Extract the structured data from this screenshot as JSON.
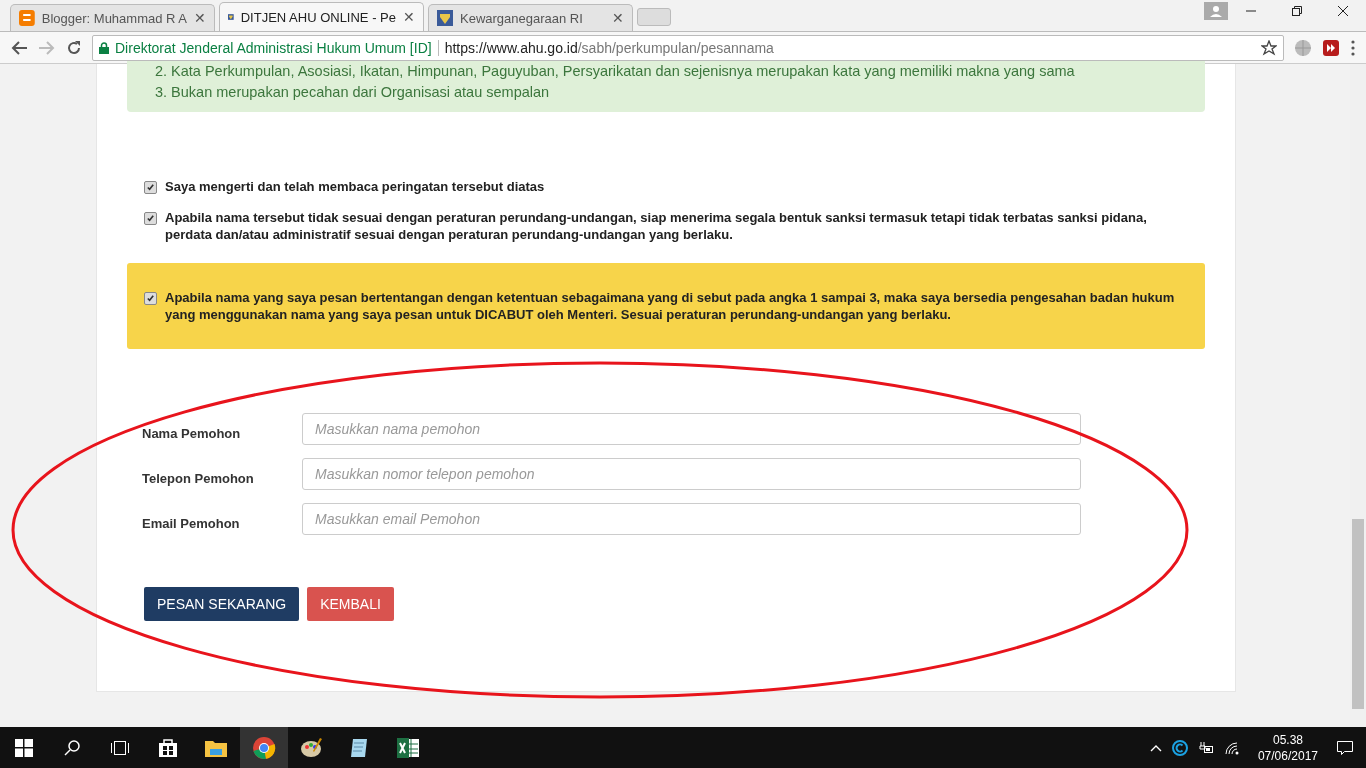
{
  "browser": {
    "tabs": [
      {
        "title": "Blogger: Muhammad R A",
        "kind": "blogger",
        "selected": false,
        "close": "✕"
      },
      {
        "title": "DITJEN AHU ONLINE - Pe",
        "kind": "emblem",
        "selected": true,
        "close": "✕"
      },
      {
        "title": "Kewarganegaraan RI",
        "kind": "emblem",
        "selected": false,
        "close": "✕"
      }
    ],
    "site_name": "Direktorat Jenderal Administrasi Hukum Umum [ID]",
    "url_host": "https://www.ahu.go.id",
    "url_path": "/sabh/perkumpulan/pesannama"
  },
  "notice": {
    "items": [
      {
        "number": "2.",
        "text": "Kata Perkumpulan, Asosiasi, Ikatan, Himpunan, Paguyuban, Persyarikatan dan sejenisnya merupakan kata yang memiliki makna yang sama"
      },
      {
        "number": "3.",
        "text": "Bukan merupakan pecahan dari Organisasi atau sempalan"
      }
    ]
  },
  "agreements": [
    {
      "text": "Saya mengerti dan telah membaca peringatan tersebut diatas",
      "checked": true
    },
    {
      "text": "Apabila nama tersebut tidak sesuai dengan peraturan perundang-undangan, siap menerima segala bentuk sanksi termasuk tetapi tidak terbatas sanksi pidana, perdata dan/atau administratif sesuai dengan peraturan perundang-undangan yang berlaku.",
      "checked": true
    }
  ],
  "warning": {
    "text": "Apabila nama yang saya pesan bertentangan dengan ketentuan sebagaimana yang di sebut pada angka 1 sampai 3, maka saya bersedia pengesahan badan hukum yang menggunakan nama yang saya pesan untuk DICABUT oleh Menteri. Sesuai peraturan perundang-undangan yang berlaku.",
    "checked": true
  },
  "form": {
    "fields": [
      {
        "label": "Nama Pemohon",
        "placeholder": "Masukkan nama pemohon"
      },
      {
        "label": "Telepon Pemohon",
        "placeholder": "Masukkan nomor telepon pemohon"
      },
      {
        "label": "Email Pemohon",
        "placeholder": "Masukkan email Pemohon"
      }
    ],
    "buttons": [
      {
        "label": "PESAN SEKARANG",
        "kind": "primary"
      },
      {
        "label": "KEMBALI",
        "kind": "danger"
      }
    ]
  },
  "taskbar": {
    "apps": [
      {
        "kind": "explorer",
        "active": false
      },
      {
        "kind": "chrome",
        "active": true
      },
      {
        "kind": "paint",
        "active": false
      },
      {
        "kind": "notepad",
        "active": false
      },
      {
        "kind": "excel",
        "active": false
      }
    ],
    "time": "05.38",
    "date": "07/06/2017"
  }
}
